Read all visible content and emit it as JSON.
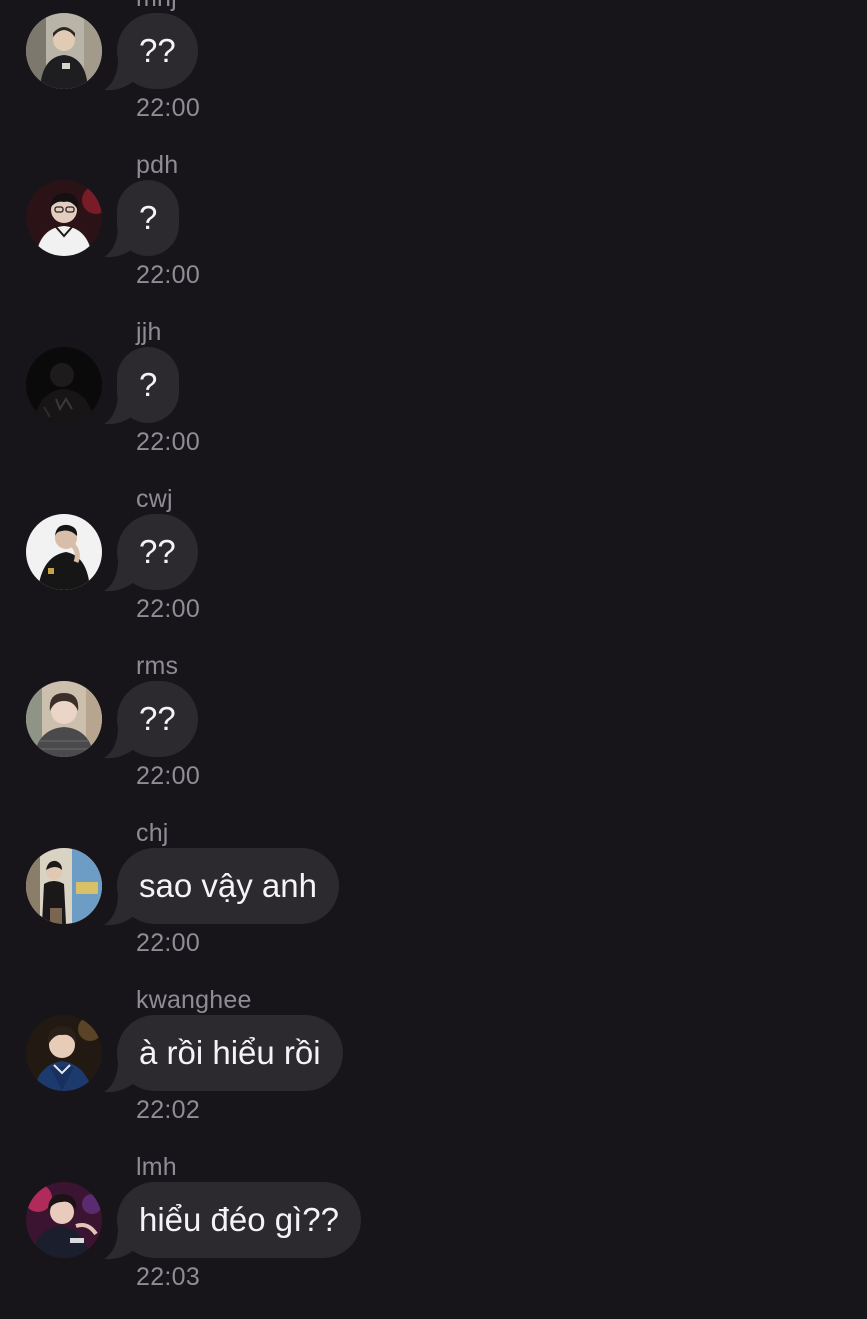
{
  "colors": {
    "background": "#17141a",
    "bubble": "#2c292f",
    "message_text": "#f4f3f5",
    "meta_text": "#8f8c93"
  },
  "messages": [
    {
      "sender": "mhj",
      "text": "??",
      "time": "22:00",
      "avatar": "profile-photo-1"
    },
    {
      "sender": "pdh",
      "text": "?",
      "time": "22:00",
      "avatar": "profile-photo-2"
    },
    {
      "sender": "jjh",
      "text": "?",
      "time": "22:00",
      "avatar": "profile-photo-3"
    },
    {
      "sender": "cwj",
      "text": "??",
      "time": "22:00",
      "avatar": "profile-photo-4"
    },
    {
      "sender": "rms",
      "text": "??",
      "time": "22:00",
      "avatar": "profile-photo-5"
    },
    {
      "sender": "chj",
      "text": "sao vậy anh",
      "time": "22:00",
      "avatar": "profile-photo-6"
    },
    {
      "sender": "kwanghee",
      "text": "à rồi hiểu rồi",
      "time": "22:02",
      "avatar": "profile-photo-7"
    },
    {
      "sender": "lmh",
      "text": "hiểu đéo gì??",
      "time": "22:03",
      "avatar": "profile-photo-8"
    }
  ]
}
